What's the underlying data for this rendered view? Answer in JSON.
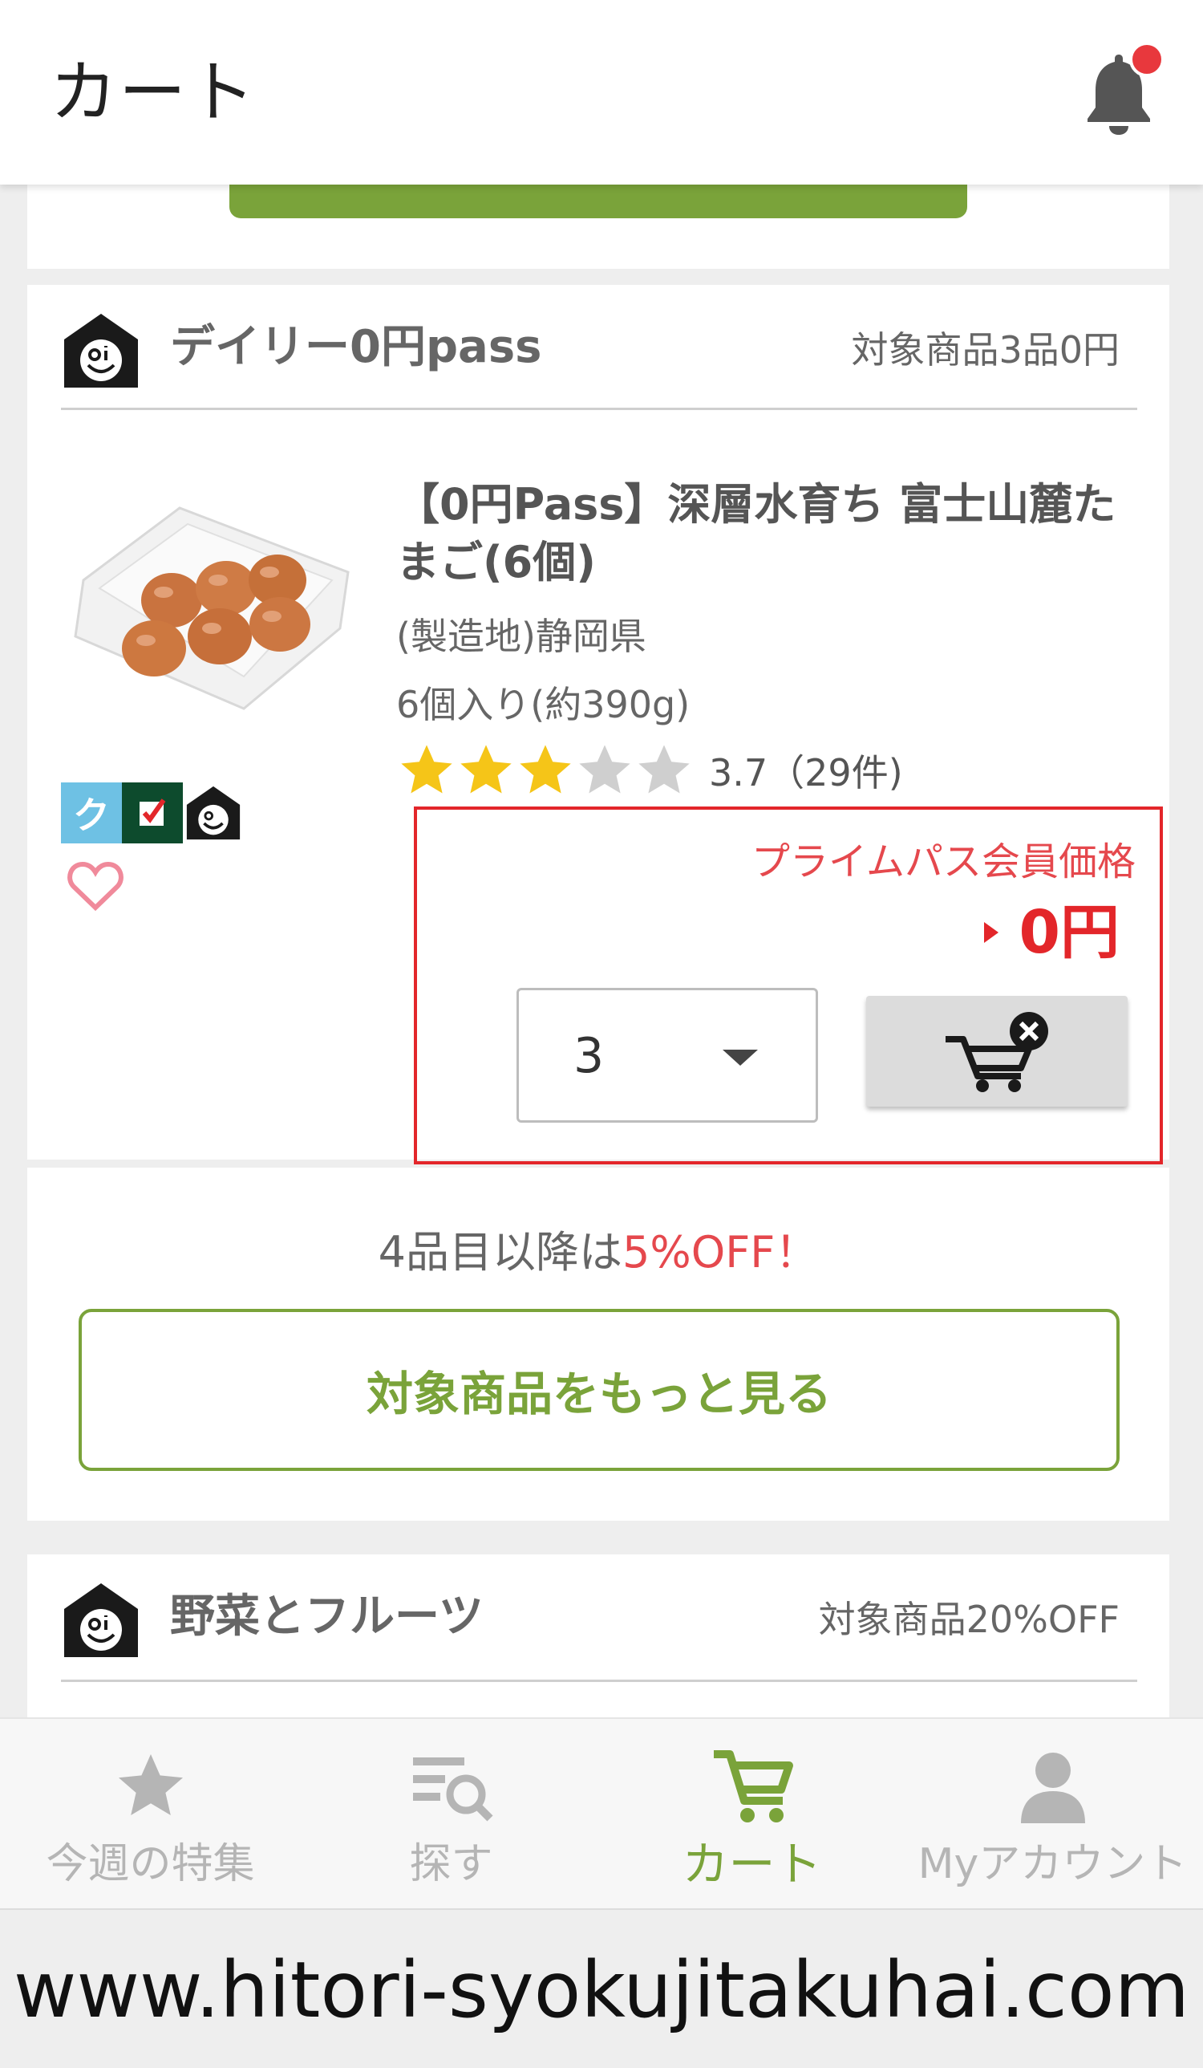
{
  "header": {
    "title": "カート",
    "icon": "bell-icon"
  },
  "daily_section": {
    "title": "デイリー0円pass",
    "note": "対象商品3品0円"
  },
  "product": {
    "name": "【0円Pass】深層水育ち 富士山麓たまご(6個)",
    "origin": "(製造地)静岡県",
    "size": "6個入り(約390g)",
    "rating_value": 3.7,
    "rating_text": "3.7（29件)",
    "badges": [
      "ク",
      "check-icon",
      "oisix-logo-icon"
    ],
    "price_label": "プライムパス会員価格",
    "price": "0円",
    "quantity": "3"
  },
  "promo": {
    "prefix": "4品目以降は",
    "highlight": "5%OFF！"
  },
  "more_button": "対象商品をもっと見る",
  "veg_section": {
    "title": "野菜とフルーツ",
    "note": "対象商品20%OFF"
  },
  "nav": [
    {
      "label": "今週の特集",
      "icon": "star-icon",
      "active": false
    },
    {
      "label": "探す",
      "icon": "search-list-icon",
      "active": false
    },
    {
      "label": "カート",
      "icon": "cart-icon",
      "active": true
    },
    {
      "label": "Myアカウント",
      "icon": "account-icon",
      "active": false
    }
  ],
  "watermark": "www.hitori-syokujitakuhai.com",
  "colors": {
    "accent": "#7aa33a",
    "price_red": "#e3262a",
    "notification": "#e8383d",
    "star": "#f5c518"
  }
}
